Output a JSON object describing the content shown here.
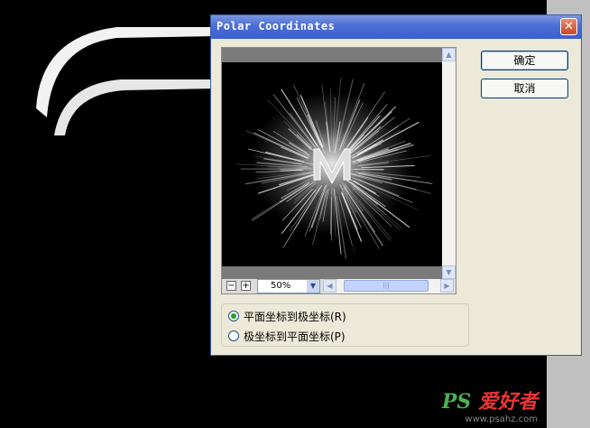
{
  "dialog": {
    "title": "Polar Coordinates",
    "close_icon": "close-icon",
    "ok_label": "确定",
    "cancel_label": "取消"
  },
  "preview": {
    "zoom_value": "50%",
    "zoom_out_label": "−",
    "zoom_in_label": "+"
  },
  "options": {
    "selected": "rect-to-polar",
    "rect_to_polar_label": "平面坐标到极坐标(R)",
    "polar_to_rect_label": "极坐标到平面坐标(P)"
  },
  "watermark": {
    "logo_ps": "PS",
    "logo_text": "爱好者",
    "url": "www.psahz.com"
  },
  "colors": {
    "titlebar": "#3b5ecf",
    "dialog_bg": "#ece9d8",
    "canvas_bg": "#000000",
    "radio_dot": "#21a121"
  }
}
